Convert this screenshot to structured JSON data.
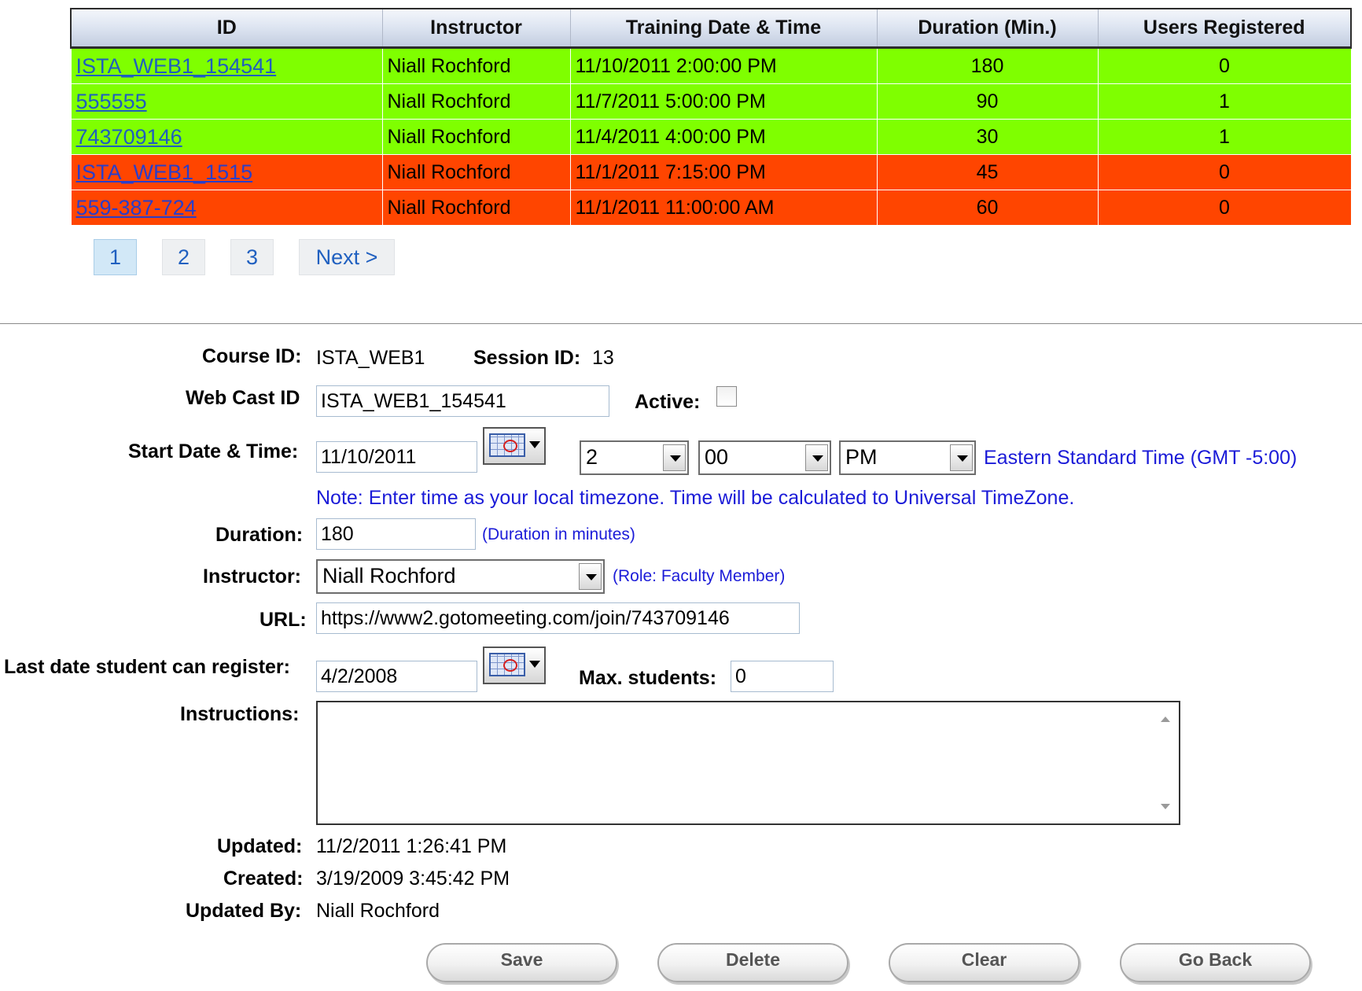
{
  "grid": {
    "columns": [
      "ID",
      "Instructor",
      "Training Date & Time",
      "Duration (Min.)",
      "Users Registered"
    ],
    "rows": [
      {
        "id": "ISTA_WEB1_154541",
        "instructor": "Niall Rochford",
        "datetime": "11/10/2011 2:00:00 PM",
        "duration": "180",
        "users": "0",
        "status": "green"
      },
      {
        "id": "555555",
        "instructor": "Niall Rochford",
        "datetime": "11/7/2011 5:00:00 PM",
        "duration": "90",
        "users": "1",
        "status": "green"
      },
      {
        "id": "743709146",
        "instructor": "Niall Rochford",
        "datetime": "11/4/2011 4:00:00 PM",
        "duration": "30",
        "users": "1",
        "status": "green"
      },
      {
        "id": "ISTA_WEB1_1515",
        "instructor": "Niall Rochford",
        "datetime": "11/1/2011 7:15:00 PM",
        "duration": "45",
        "users": "0",
        "status": "red"
      },
      {
        "id": "559-387-724",
        "instructor": "Niall Rochford",
        "datetime": "11/1/2011 11:00:00 AM",
        "duration": "60",
        "users": "0",
        "status": "red"
      }
    ],
    "status_colors": {
      "green": "#7fff00",
      "red": "#ff4500"
    }
  },
  "pager": {
    "pages": [
      "1",
      "2",
      "3"
    ],
    "current": "1",
    "next_label": "Next >"
  },
  "form": {
    "course_id_label": "Course ID:",
    "course_id": "ISTA_WEB1",
    "session_id_label": "Session ID:",
    "session_id": "13",
    "webcast_label": "Web Cast ID",
    "webcast_value": "ISTA_WEB1_154541",
    "active_label": "Active:",
    "active_checked": false,
    "start_label": "Start Date & Time:",
    "start_date": "11/10/2011",
    "hour": "2",
    "minute": "00",
    "ampm": "PM",
    "timezone": "Eastern Standard Time (GMT -5:00)",
    "note": "Note: Enter time as your local timezone. Time will be calculated to Universal TimeZone.",
    "duration_label": "Duration:",
    "duration_value": "180",
    "duration_hint": "(Duration in minutes)",
    "instructor_label": "Instructor:",
    "instructor_value": "Niall Rochford",
    "instructor_role": "(Role: Faculty Member)",
    "url_label": "URL:",
    "url_value": "https://www2.gotomeeting.com/join/743709146",
    "lastdate_label": "Last date student can register:",
    "lastdate_value": "4/2/2008",
    "max_label": "Max. students:",
    "max_value": "0",
    "instructions_label": "Instructions:",
    "instructions_value": "",
    "updated_label": "Updated:",
    "updated_value": "11/2/2011 1:26:41 PM",
    "created_label": "Created:",
    "created_value": "3/19/2009 3:45:42 PM",
    "updatedby_label": "Updated By:",
    "updatedby_value": "Niall Rochford"
  },
  "buttons": {
    "save": "Save",
    "delete": "Delete",
    "clear": "Clear",
    "goback": "Go Back"
  }
}
